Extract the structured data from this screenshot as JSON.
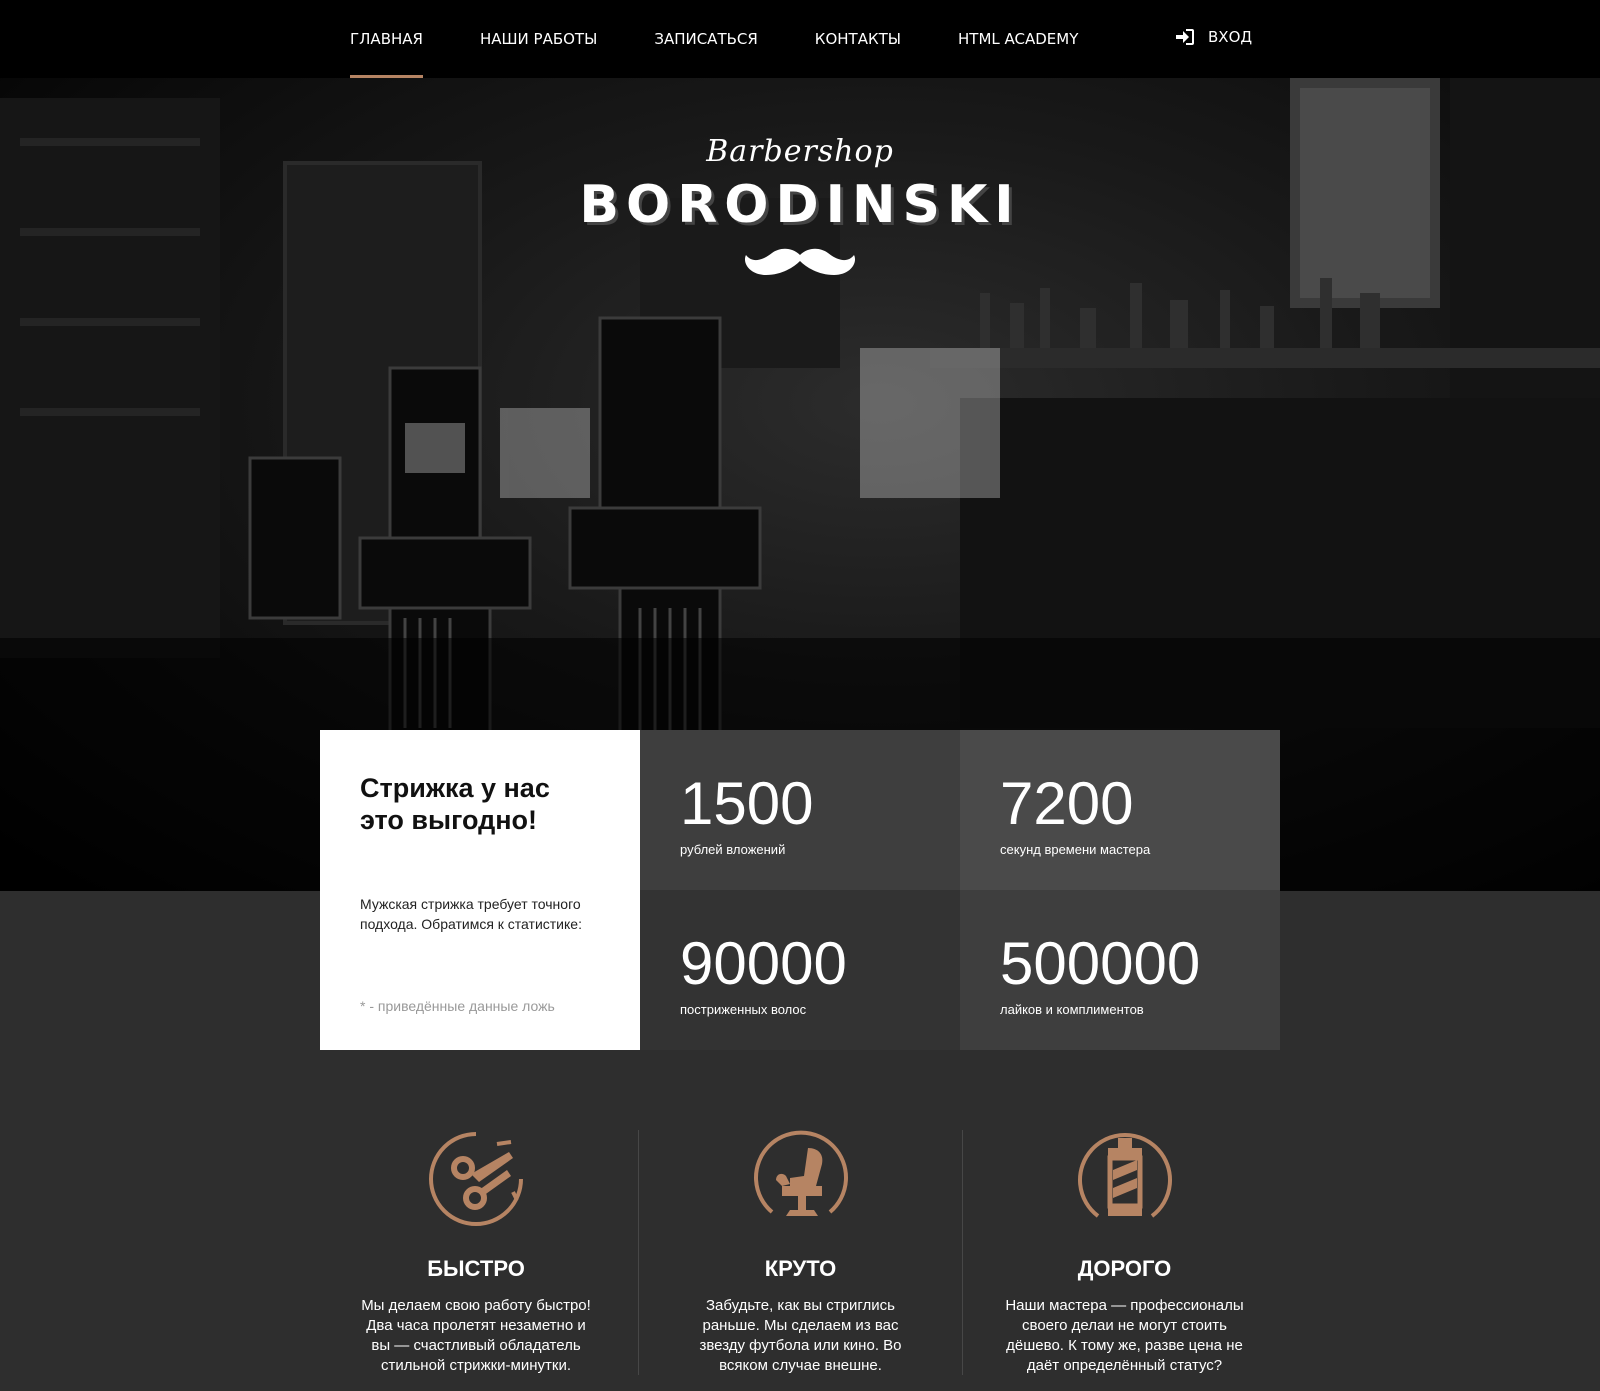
{
  "nav": {
    "items": [
      {
        "label": "ГЛАВНАЯ",
        "active": true
      },
      {
        "label": "НАШИ РАБОТЫ",
        "active": false
      },
      {
        "label": "ЗАПИСАТЬСЯ",
        "active": false
      },
      {
        "label": "КОНТАКТЫ",
        "active": false
      },
      {
        "label": "HTML ACADEMY",
        "active": false
      }
    ],
    "login_label": "ВХОД",
    "login_icon": "sign-in-icon"
  },
  "logo": {
    "script": "Barbershop",
    "name": "BORODINSKI",
    "icon": "mustache-icon"
  },
  "stats": {
    "title": "Стрижка у нас это выгодно!",
    "text": "Мужская стрижка требует точного подхода. Обратимся к статистике:",
    "note": "* - приведённые данные ложь",
    "items": [
      {
        "value": "1500",
        "label": "рублей вложений"
      },
      {
        "value": "7200",
        "label": "секунд времени мастера"
      },
      {
        "value": "90000",
        "label": "постриженных волос"
      },
      {
        "value": "500000",
        "label": "лайков и комплиментов"
      }
    ]
  },
  "features": [
    {
      "title": "БЫСТРО",
      "text": "Мы делаем свою работу быстро! Два часа пролетят незаметно и вы — счастливый обладатель стильной стрижки-минутки.",
      "icon": "scissors-icon"
    },
    {
      "title": "КРУТО",
      "text": "Забудьте, как вы стриглись раньше. Мы сделаем из вас звезду футбола или кино. Во всяком случае внешне.",
      "icon": "barber-chair-icon"
    },
    {
      "title": "ДОРОГО",
      "text": "Наши мастера — профессионалы своего делаи не могут стоить дёшево. К тому же, разве цена не даёт определённый статус?",
      "icon": "barber-pole-icon"
    }
  ],
  "colors": {
    "accent": "#b68463",
    "page_bg": "#2e2e2e",
    "header_bg": "#000000"
  }
}
